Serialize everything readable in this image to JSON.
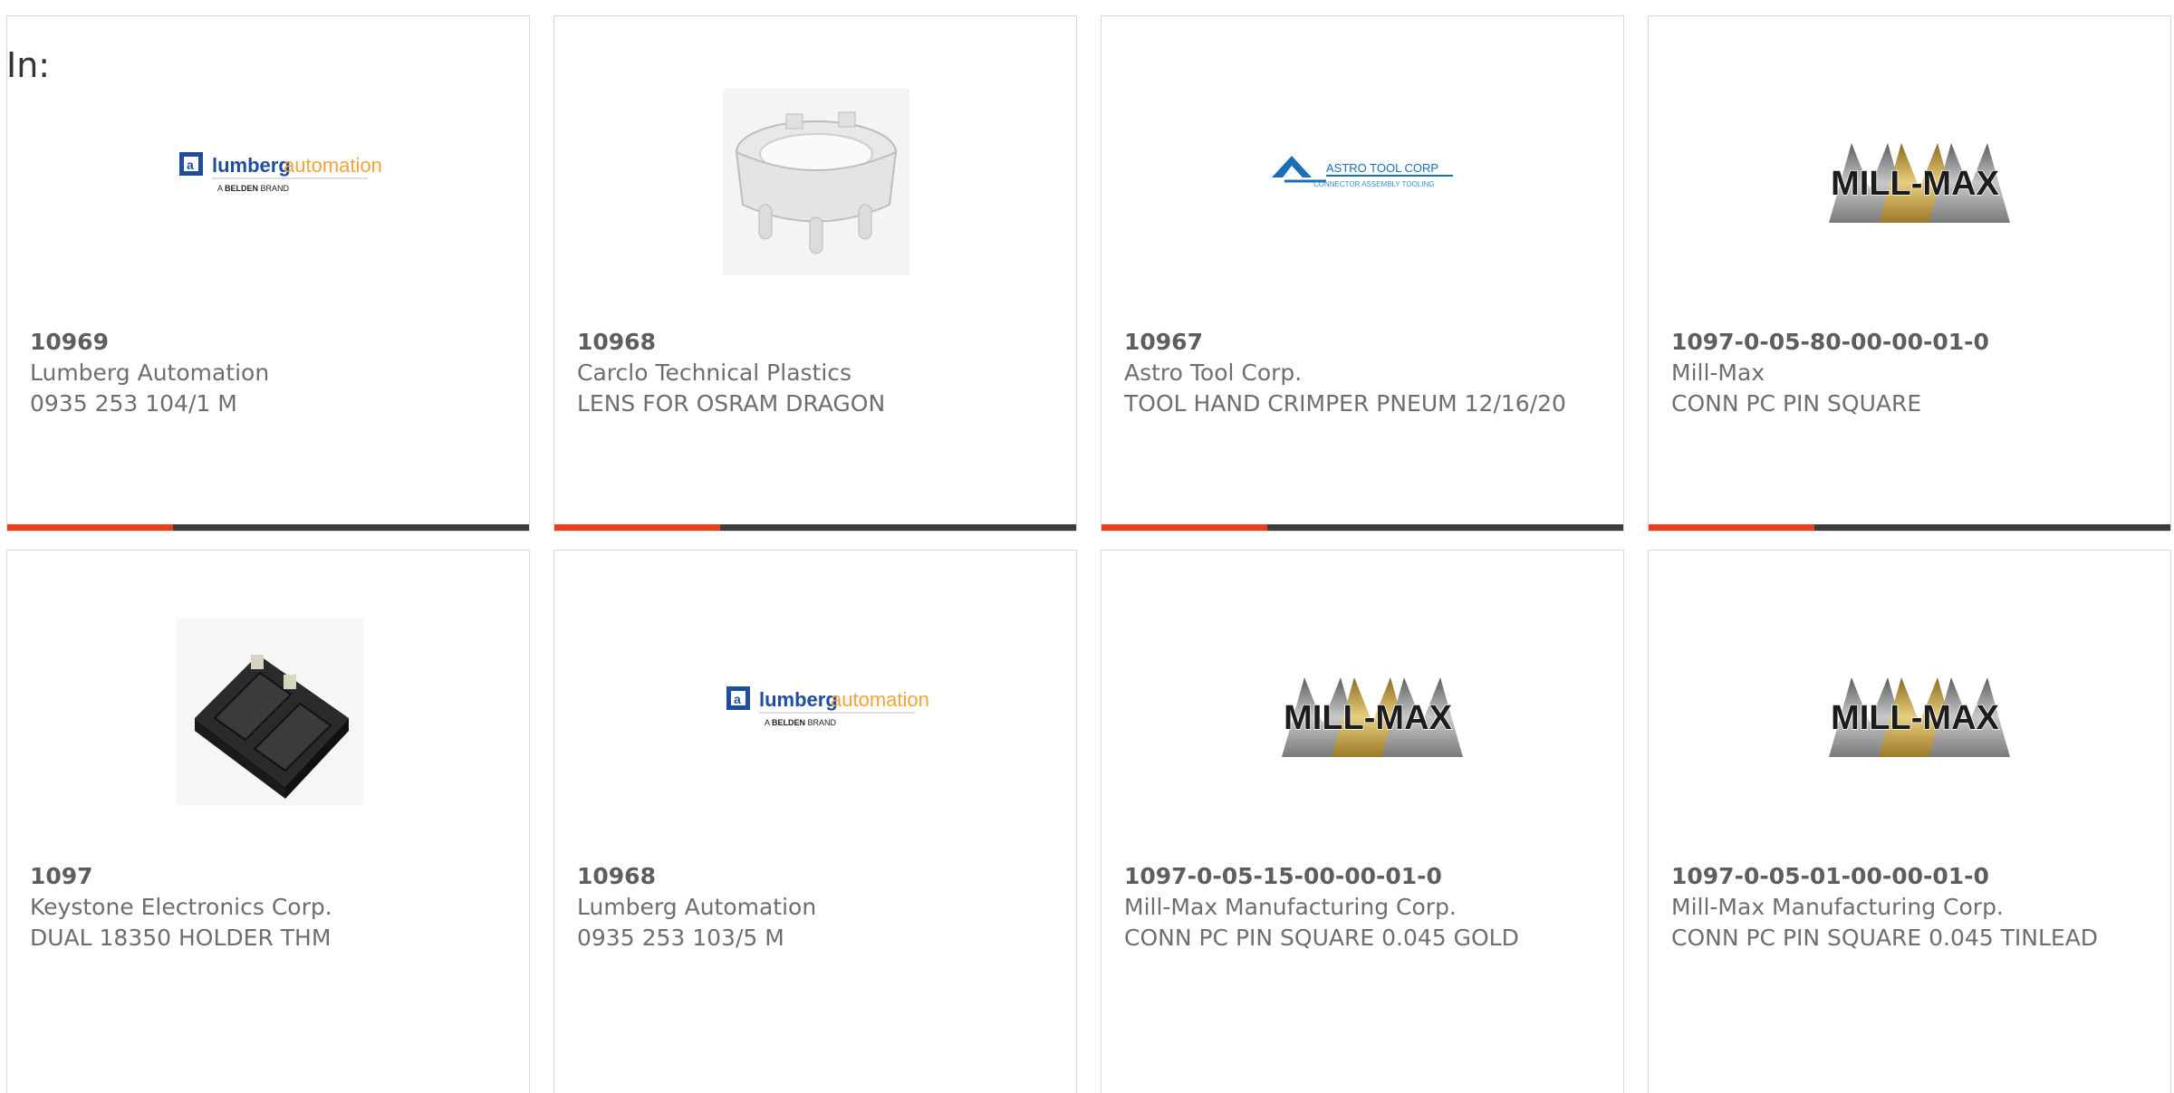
{
  "filter_label": "In:",
  "colors": {
    "accent": "#e8401c",
    "bar": "#3d3d3d"
  },
  "cards": [
    {
      "part": "10969",
      "manufacturer": "Lumberg Automation",
      "description": "0935 253 104/1 M",
      "logo": {
        "word1": "lumberg",
        "word2": "automation",
        "sub1": "A ",
        "sub2": "BELDEN",
        "sub3": " BRAND"
      }
    },
    {
      "part": "10968",
      "manufacturer": "Carclo Technical Plastics",
      "description": "LENS FOR OSRAM DRAGON"
    },
    {
      "part": "10967",
      "manufacturer": "Astro Tool Corp.",
      "description": "TOOL HAND CRIMPER PNEUM 12/16/20",
      "logo": {
        "name": "ASTRO TOOL CORP",
        "tagline": "CONNECTOR ASSEMBLY TOOLING"
      }
    },
    {
      "part": "1097-0-05-80-00-00-01-0",
      "manufacturer": "Mill-Max",
      "description": "CONN PC PIN SQUARE",
      "logo": {
        "name": "MILL-MAX"
      }
    },
    {
      "part": "1097",
      "manufacturer": "Keystone Electronics Corp.",
      "description": "DUAL 18350 HOLDER THM"
    },
    {
      "part": "10968",
      "manufacturer": "Lumberg Automation",
      "description": "0935 253 103/5 M",
      "logo": {
        "word1": "lumberg",
        "word2": "automation",
        "sub1": "A ",
        "sub2": "BELDEN",
        "sub3": " BRAND"
      }
    },
    {
      "part": "1097-0-05-15-00-00-01-0",
      "manufacturer": "Mill-Max Manufacturing Corp.",
      "description": "CONN PC PIN SQUARE 0.045 GOLD",
      "logo": {
        "name": "MILL-MAX"
      }
    },
    {
      "part": "1097-0-05-01-00-00-01-0",
      "manufacturer": "Mill-Max Manufacturing Corp.",
      "description": "CONN PC PIN SQUARE 0.045 TINLEAD",
      "logo": {
        "name": "MILL-MAX"
      }
    }
  ]
}
